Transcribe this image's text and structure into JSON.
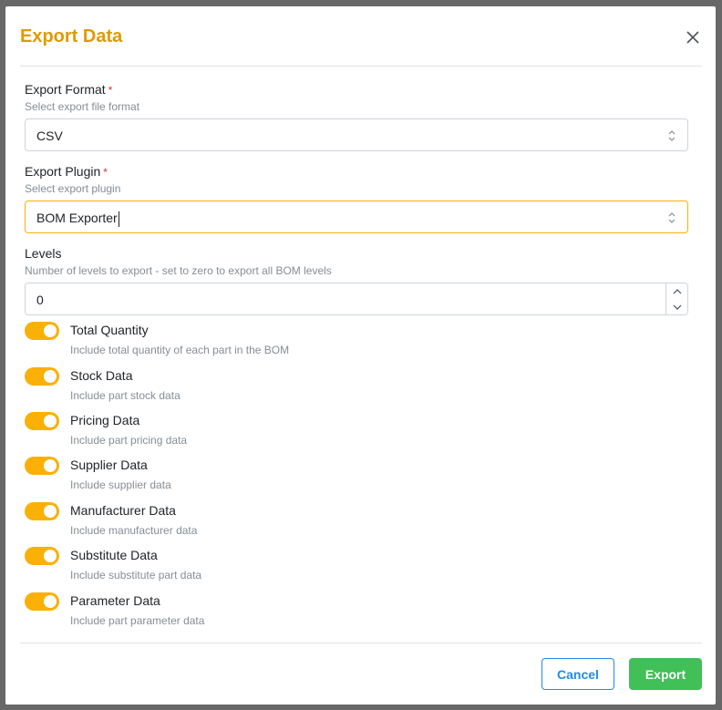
{
  "modal": {
    "title": "Export Data",
    "close_icon": "close-icon",
    "accent_color": "#fab005",
    "title_color": "#e09a00"
  },
  "fields": {
    "format": {
      "label": "Export Format",
      "required": "*",
      "description": "Select export file format",
      "value": "CSV"
    },
    "plugin": {
      "label": "Export Plugin",
      "required": "*",
      "description": "Select export plugin",
      "value": "BOM Exporter"
    },
    "levels": {
      "label": "Levels",
      "description": "Number of levels to export - set to zero to export all BOM levels",
      "value": "0"
    }
  },
  "toggles": [
    {
      "label": "Total Quantity",
      "description": "Include total quantity of each part in the BOM",
      "checked": true
    },
    {
      "label": "Stock Data",
      "description": "Include part stock data",
      "checked": true
    },
    {
      "label": "Pricing Data",
      "description": "Include part pricing data",
      "checked": true
    },
    {
      "label": "Supplier Data",
      "description": "Include supplier data",
      "checked": true
    },
    {
      "label": "Manufacturer Data",
      "description": "Include manufacturer data",
      "checked": true
    },
    {
      "label": "Substitute Data",
      "description": "Include substitute part data",
      "checked": true
    },
    {
      "label": "Parameter Data",
      "description": "Include part parameter data",
      "checked": true
    }
  ],
  "footer": {
    "cancel_label": "Cancel",
    "export_label": "Export",
    "cancel_color": "#228be6",
    "export_color": "#40c057"
  }
}
